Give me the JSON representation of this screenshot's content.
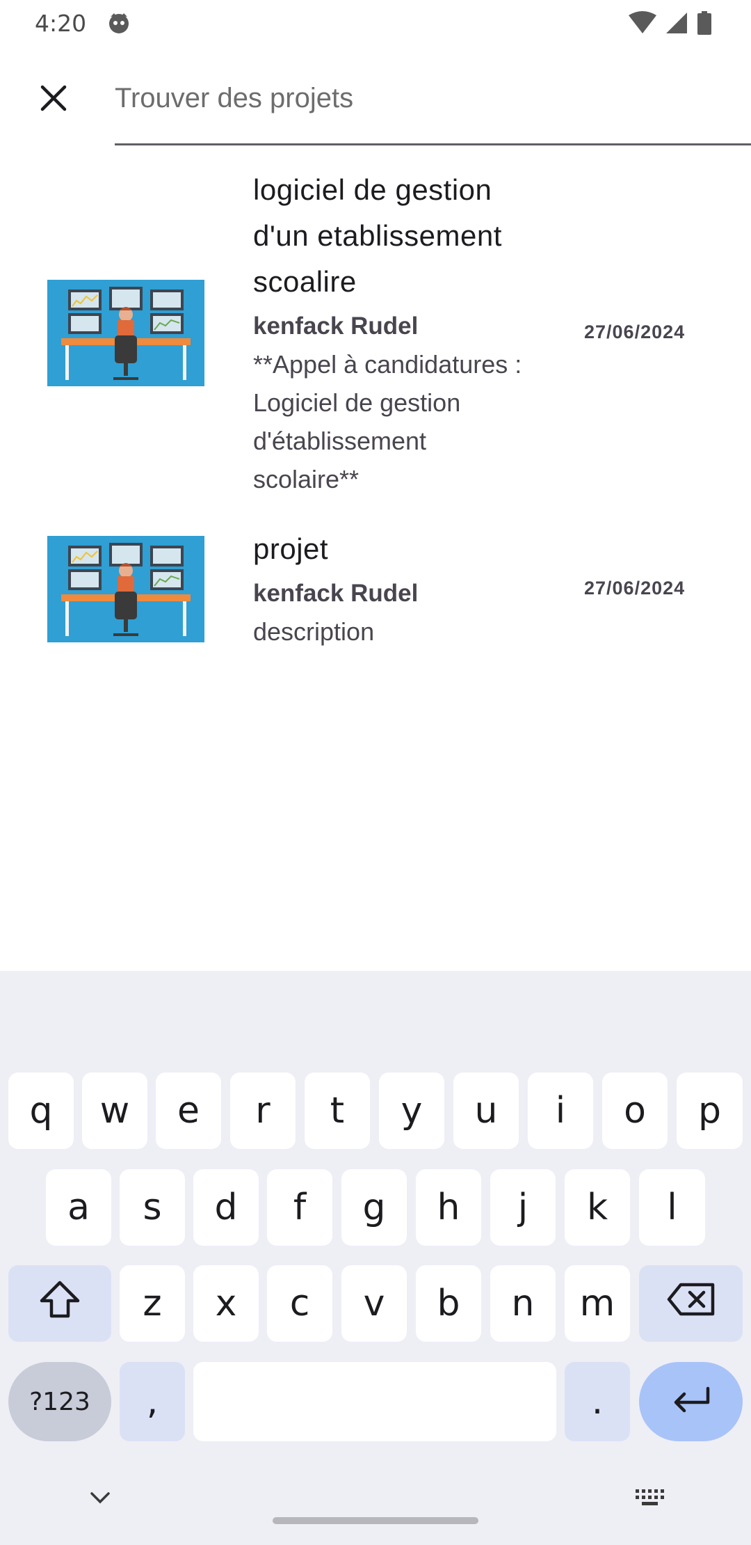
{
  "status_bar": {
    "time": "4:20",
    "icons": [
      "face-icon",
      "wifi-icon",
      "signal-icon",
      "battery-icon"
    ]
  },
  "search": {
    "placeholder": "Trouver des projets",
    "value": ""
  },
  "results": [
    {
      "title_lines": [
        "logiciel de gestion",
        "d'un etablissement",
        "scoalire"
      ],
      "author": "kenfack Rudel",
      "description_lines": [
        "**Appel à candidatures :",
        "Logiciel de gestion",
        "d'établissement",
        "scolaire**"
      ],
      "date": "27/06/2024"
    },
    {
      "title_lines": [
        "projet"
      ],
      "author": "kenfack Rudel",
      "description_lines": [
        "description"
      ],
      "date": "27/06/2024"
    }
  ],
  "keyboard": {
    "row1": [
      "q",
      "w",
      "e",
      "r",
      "t",
      "y",
      "u",
      "i",
      "o",
      "p"
    ],
    "row2": [
      "a",
      "s",
      "d",
      "f",
      "g",
      "h",
      "j",
      "k",
      "l"
    ],
    "row3": [
      "z",
      "x",
      "c",
      "v",
      "b",
      "n",
      "m"
    ],
    "symbols_label": "?123",
    "comma": ",",
    "period": "."
  },
  "colors": {
    "thumbnail_bg": "#2f9fd4",
    "keyboard_bg": "#eeeef5",
    "enter_key": "#a8c3f8",
    "function_key": "#dbe1f5"
  }
}
